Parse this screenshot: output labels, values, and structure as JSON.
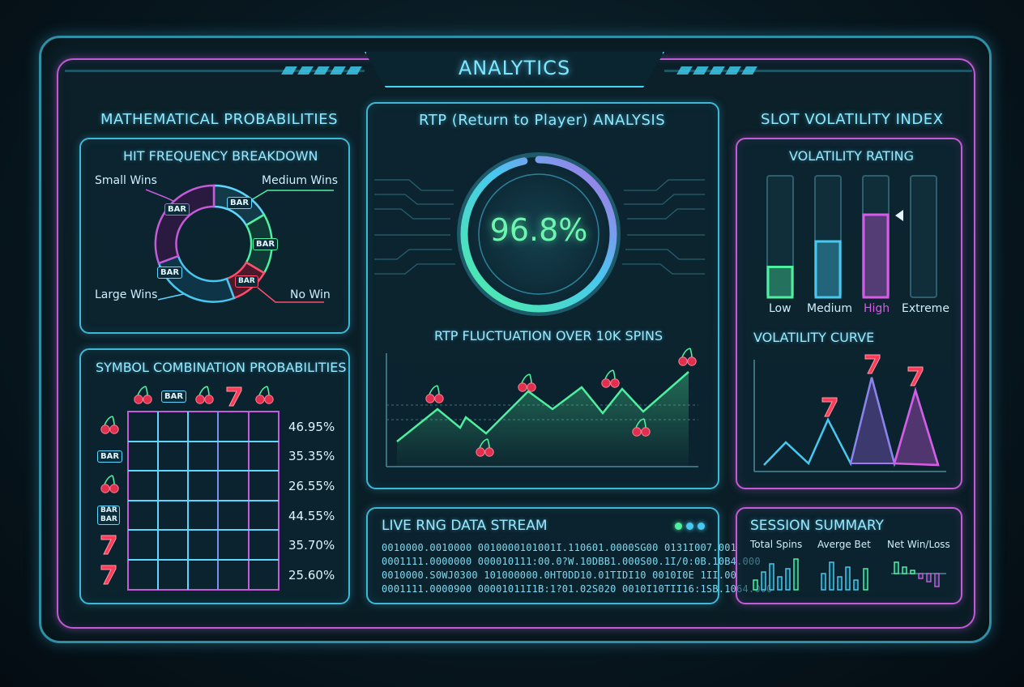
{
  "header": {
    "title": "ANALYTICS"
  },
  "math_prob": {
    "title": "MATHEMATICAL PROBABILITIES",
    "hit_freq": {
      "title": "HIT FREQUENCY BREAKDOWN",
      "labels": {
        "small": "Small Wins",
        "medium": "Medium Wins",
        "large": "Large Wins",
        "none": "No Win"
      },
      "badge": "BAR"
    },
    "symbol_combo": {
      "title": "SYMBOL COMBINATION PROBABILITIES",
      "col_symbols": [
        "cherry-icon",
        "BAR",
        "cherry-icon",
        "seven-icon",
        "cherry-icon"
      ],
      "rows": [
        {
          "symbol": "cherry-icon",
          "pct": "46.95%"
        },
        {
          "symbol": "BAR",
          "pct": "35.35%"
        },
        {
          "symbol": "cherry-icon",
          "pct": "26.55%"
        },
        {
          "symbol": "BAR BAR",
          "pct": "44.55%"
        },
        {
          "symbol": "seven-icon",
          "pct": "35.70%"
        },
        {
          "symbol": "seven-icon",
          "pct": "25.60%"
        }
      ]
    }
  },
  "rtp": {
    "title": "RTP (Return to Player) ANALYSIS",
    "value": "96.8%",
    "value_number": 96.8,
    "fluct_title": "RTP FLUCTUATION OVER 10K SPINS"
  },
  "volatility": {
    "title": "SLOT VOLATILITY INDEX",
    "rating_title": "VOLATILITY RATING",
    "bars": [
      {
        "label": "Low",
        "level": 0.25,
        "color": "#4ef0a0"
      },
      {
        "label": "Medium",
        "level": 0.46,
        "color": "#47c8f0"
      },
      {
        "label": "High",
        "level": 0.68,
        "color": "#d85ae6",
        "selected": true
      },
      {
        "label": "Extreme",
        "level": 0,
        "color": "#3b6a78"
      }
    ],
    "curve_title": "VOLATILITY CURVE"
  },
  "rng": {
    "title": "LIVE RNG DATA STREAM",
    "lines": [
      "0010000.0010000 0010000101001I.110601.0000SG00 0131I007.001",
      "0001111.0000000 000010111:00.0?W.10DBB1.000S00.1I/0:0B.10B4.000",
      "0010000.S0WJ0300 101000000.0HT0DD10.01TIDI10 0010I0E 1II.00",
      "0001111.0000900 00001011I1B:1?01.02S020 0010I10TII16:1SB.1064.000"
    ]
  },
  "session": {
    "title": "SESSION SUMMARY",
    "stats": [
      {
        "label": "Total Spins"
      },
      {
        "label": "Averge Bet"
      },
      {
        "label": "Net Win/Loss"
      }
    ]
  },
  "colors": {
    "cyan": "#47d6ef",
    "pink": "#c45bd8",
    "green": "#4ef0a0",
    "red": "#ff4d6d"
  }
}
